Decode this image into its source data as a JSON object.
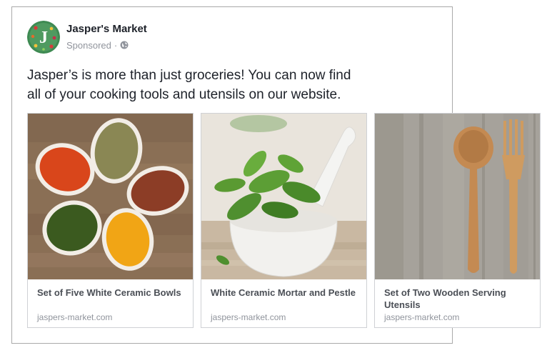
{
  "post": {
    "page_name": "Jasper's Market",
    "sponsored_label": "Sponsored",
    "separator": "·",
    "audience_icon": "globe-icon",
    "avatar_letter": "J",
    "text_line1": "Jasper’s is more than just groceries! You can now find",
    "text_line2": "all of your cooking tools and utensils on our website."
  },
  "carousel": {
    "items": [
      {
        "title": "Set of Five White Ceramic Bowls",
        "domain": "jaspers-market.com",
        "image": "spice-bowls-image"
      },
      {
        "title": "White Ceramic Mortar and Pestle",
        "domain": "jaspers-market.com",
        "image": "mortar-pestle-image"
      },
      {
        "title": "Set of Two Wooden Serving Utensils",
        "domain": "jaspers-market.com",
        "image": "wooden-utensils-image"
      }
    ]
  },
  "colors": {
    "text_primary": "#1d2129",
    "text_secondary": "#90949c",
    "avatar_green": "#3e8a52"
  }
}
